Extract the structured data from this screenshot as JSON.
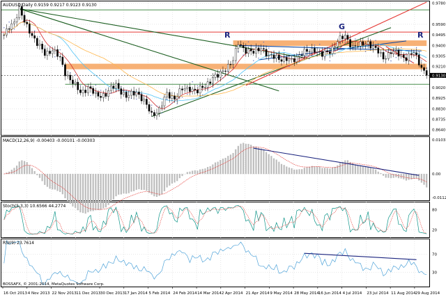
{
  "chart_data": {
    "type": "candlestick",
    "symbol_line": "AUDUSD,Daily  0.9159 0.9217 0.9123 0.9130",
    "last_price_label": "0.9130",
    "price_ticks": [
      "0.9780",
      "0.9590",
      "0.9495",
      "0.9400",
      "0.9305",
      "0.9210",
      "0.9130",
      "0.9020",
      "0.8925",
      "0.8830",
      "0.8735",
      "0.8640"
    ],
    "price_range": [
      0.86,
      0.979
    ],
    "date_ticks": [
      "16 Oct 2013",
      "4 Nov 2013",
      "22 Nov 2013",
      "11 Dec 2013",
      "30 Dec 2013",
      "17 Jan 2014",
      "5 Feb 2014",
      "24 Feb 2014",
      "14 Mar 2014",
      "2 Apr 2014",
      "21 Apr 2014",
      "9 May 2014",
      "28 May 2014",
      "16 Jun 2014",
      "4 Jul 2014",
      "23 Jul 2014",
      "11 Aug 2014",
      "29 Aug 2014"
    ],
    "close_anchors": [
      [
        0,
        0.948
      ],
      [
        2,
        0.957
      ],
      [
        4,
        0.962
      ],
      [
        6,
        0.972
      ],
      [
        8,
        0.961
      ],
      [
        10,
        0.954
      ],
      [
        13,
        0.941
      ],
      [
        16,
        0.933
      ],
      [
        19,
        0.936
      ],
      [
        22,
        0.928
      ],
      [
        24,
        0.916
      ],
      [
        27,
        0.906
      ],
      [
        30,
        0.898
      ],
      [
        33,
        0.902
      ],
      [
        36,
        0.895
      ],
      [
        40,
        0.896
      ],
      [
        44,
        0.905
      ],
      [
        48,
        0.893
      ],
      [
        52,
        0.899
      ],
      [
        55,
        0.889
      ],
      [
        58,
        0.878
      ],
      [
        61,
        0.882
      ],
      [
        64,
        0.896
      ],
      [
        67,
        0.893
      ],
      [
        70,
        0.9
      ],
      [
        73,
        0.902
      ],
      [
        76,
        0.898
      ],
      [
        79,
        0.904
      ],
      [
        82,
        0.911
      ],
      [
        84,
        0.912
      ],
      [
        87,
        0.92
      ],
      [
        90,
        0.926
      ],
      [
        92,
        0.942
      ],
      [
        95,
        0.936
      ],
      [
        98,
        0.933
      ],
      [
        101,
        0.939
      ],
      [
        104,
        0.929
      ],
      [
        107,
        0.93
      ],
      [
        110,
        0.927
      ],
      [
        113,
        0.926
      ],
      [
        116,
        0.932
      ],
      [
        119,
        0.934
      ],
      [
        122,
        0.937
      ],
      [
        125,
        0.931
      ],
      [
        128,
        0.935
      ],
      [
        131,
        0.944
      ],
      [
        134,
        0.948
      ],
      [
        137,
        0.939
      ],
      [
        140,
        0.94
      ],
      [
        143,
        0.943
      ],
      [
        146,
        0.936
      ],
      [
        149,
        0.929
      ],
      [
        152,
        0.934
      ],
      [
        155,
        0.932
      ],
      [
        158,
        0.929
      ],
      [
        161,
        0.933
      ],
      [
        164,
        0.921
      ],
      [
        166,
        0.913
      ]
    ],
    "resistance_levels": [
      0.972,
      0.952,
      0.942,
      0.921,
      0.913,
      0.905
    ],
    "annotations": [
      "R",
      "G",
      "R"
    ],
    "indicators": [
      {
        "label": "MACD(12,26,9) -0.00403 -0.00101 -0.00303",
        "ticks": [
          "0.01031",
          "0.00",
          "-0.01126"
        ]
      },
      {
        "label": "Stoch(5,3,3) 10.6566 44.2774",
        "ticks": [
          "80",
          "20"
        ]
      },
      {
        "label": "RSI(9) 23.7614",
        "ticks": [
          "70",
          "30"
        ]
      }
    ],
    "copyright": "BOSSAFX, © 2001-2014, MetaQuotes Software Corp."
  }
}
